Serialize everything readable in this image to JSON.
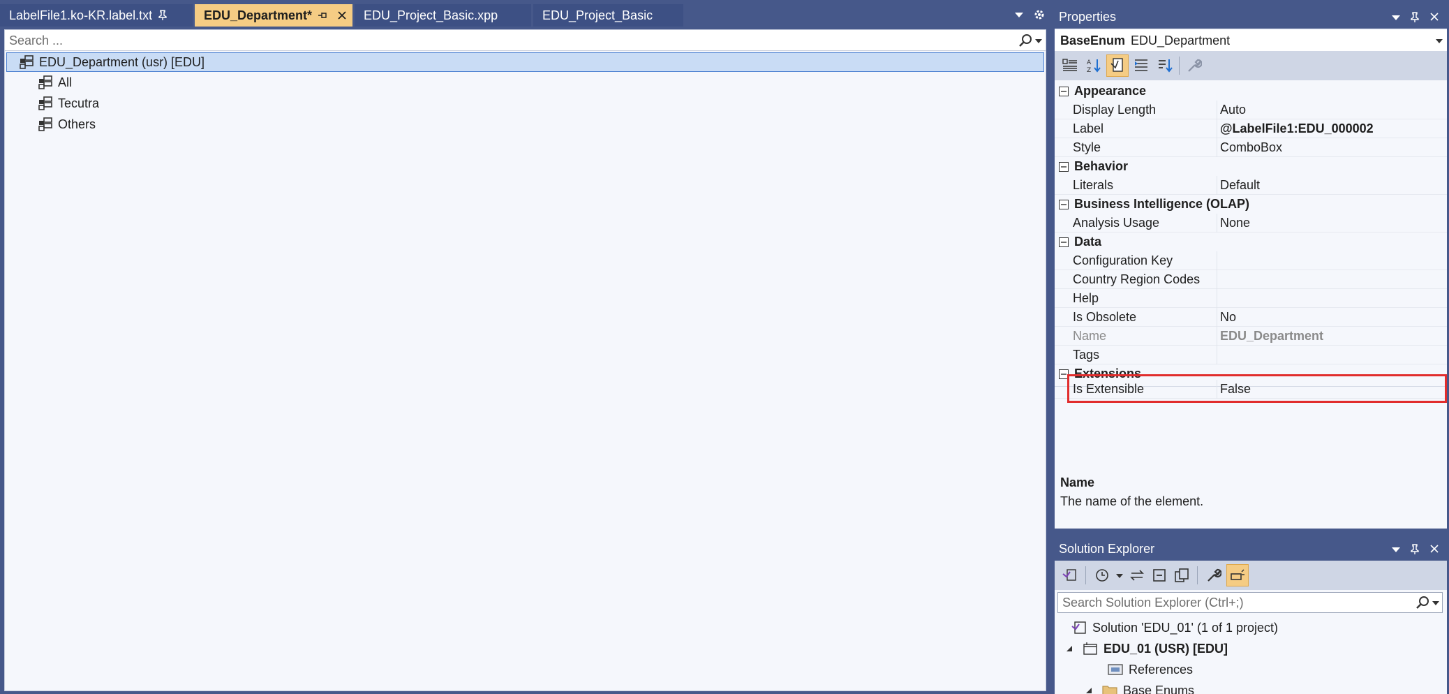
{
  "tabs": [
    {
      "label": "LabelFile1.ko-KR.label.txt",
      "active": false,
      "pinned": true
    },
    {
      "label": "EDU_Department*",
      "active": true,
      "pinned": true
    },
    {
      "label": "EDU_Project_Basic.xpp",
      "active": false
    },
    {
      "label": "EDU_Project_Basic",
      "active": false
    }
  ],
  "editor": {
    "search_placeholder": "Search ...",
    "tree": {
      "root": "EDU_Department (usr) [EDU]",
      "children": [
        "All",
        "Tecutra",
        "Others"
      ]
    }
  },
  "properties": {
    "title": "Properties",
    "object_kind": "BaseEnum",
    "object_name": "EDU_Department",
    "categories": [
      {
        "name": "Appearance",
        "rows": [
          {
            "name": "Display Length",
            "value": "Auto"
          },
          {
            "name": "Label",
            "value": "@LabelFile1:EDU_000002"
          },
          {
            "name": "Style",
            "value": "ComboBox"
          }
        ]
      },
      {
        "name": "Behavior",
        "rows": [
          {
            "name": "Literals",
            "value": "Default"
          }
        ]
      },
      {
        "name": "Business Intelligence (OLAP)",
        "rows": [
          {
            "name": "Analysis Usage",
            "value": "None"
          }
        ]
      },
      {
        "name": "Data",
        "rows": [
          {
            "name": "Configuration Key",
            "value": ""
          },
          {
            "name": "Country Region Codes",
            "value": ""
          },
          {
            "name": "Help",
            "value": ""
          },
          {
            "name": "Is Obsolete",
            "value": "No"
          },
          {
            "name": "Name",
            "value": "EDU_Department"
          },
          {
            "name": "Tags",
            "value": ""
          }
        ]
      },
      {
        "name": "Extensions",
        "rows": [
          {
            "name": "Is Extensible",
            "value": "False"
          }
        ]
      }
    ],
    "description": {
      "title": "Name",
      "text": "The name of the element."
    }
  },
  "solution_explorer": {
    "title": "Solution Explorer",
    "search_placeholder": "Search Solution Explorer (Ctrl+;)",
    "items": [
      {
        "label": "Solution 'EDU_01' (1 of 1 project)"
      },
      {
        "label": "EDU_01 (USR) [EDU]"
      },
      {
        "label": "References"
      },
      {
        "label": "Base Enums"
      }
    ]
  },
  "colors": {
    "chrome": "#46588a",
    "active_tab": "#f5cc84",
    "selection": "#c9dcf5",
    "highlight_box": "#e12d2d"
  }
}
